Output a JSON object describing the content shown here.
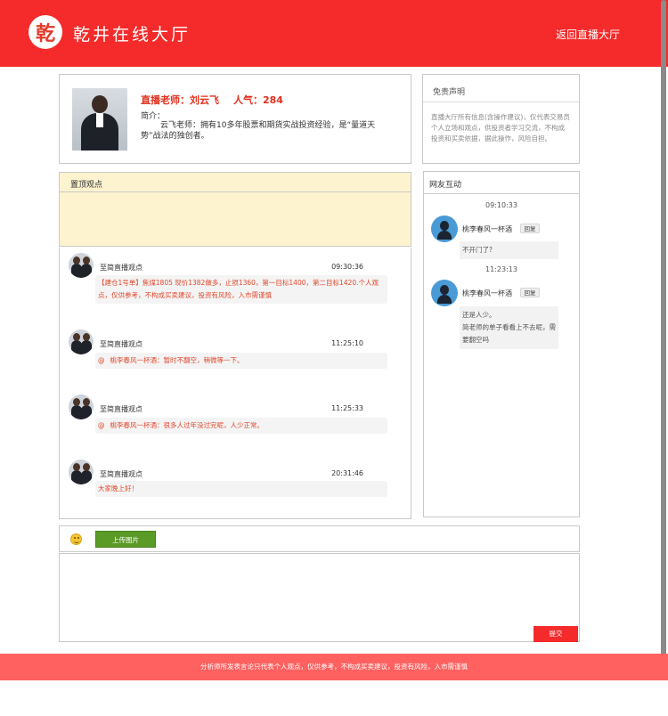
{
  "header": {
    "logo_char": "乾",
    "title": "乾井在线大厅",
    "back_link": "返回直播大厅"
  },
  "teacher": {
    "name_line": "直播老师：刘云飞",
    "popularity_line": "人气：284",
    "intro_label": "简介：",
    "intro_text": "云飞老师：拥有10多年股票和期货实战投资经验，是“量道天势”战法的独创者。"
  },
  "disclaimer": {
    "title": "免责声明",
    "text": "直播大厅所有信息(含操作建议)，仅代表交易员个人立场和观点，供投资者学习交流，不构成投资和买卖依据，据此操作，风险自担。"
  },
  "pinned": {
    "title": "置顶观点"
  },
  "feed": {
    "messages": [
      {
        "author": "至简直播观点",
        "time": "09:30:36",
        "icon": "",
        "text": "【建仓1号单】焦煤1805 现价1382做多，止损1360，第一目标1400，第二目标1420.个人观点，仅供参考，不构成买卖建议，投资有风险，入市需谨慎"
      },
      {
        "author": "至简直播观点",
        "time": "11:25:10",
        "icon": "@",
        "text": "桃李春风一杯酒：暂时不翻空，稍微等一下。"
      },
      {
        "author": "至简直播观点",
        "time": "11:25:33",
        "icon": "@",
        "text": "桃李春风一杯酒：很多人过年没过完呢，人少正常。"
      },
      {
        "author": "至简直播观点",
        "time": "20:31:46",
        "icon": "",
        "text": "大家晚上好！"
      }
    ]
  },
  "chat": {
    "title": "网友互动",
    "reply_label": "回复",
    "messages": [
      {
        "time": "09:10:33",
        "user": "桃李春风一杯酒",
        "lines": [
          "不开门了?"
        ]
      },
      {
        "time": "11:23:13",
        "user": "桃李春风一杯酒",
        "lines": [
          "还是人少。",
          "简老师的单子看看上不去呢，需要翻空吗"
        ]
      }
    ]
  },
  "composer": {
    "upload_label": "上传图片",
    "submit_label": "提交"
  },
  "footer": {
    "text": "分析师所发表言论只代表个人观点，仅供参考，不构成买卖建议，投资有风险，入市需谨慎"
  },
  "colors": {
    "brand_red": "#f52a2a",
    "footer_red": "#ff6161",
    "pinned_bg": "#fdf3cf",
    "upload_green": "#5a9a27",
    "message_text": "#e2472c"
  }
}
